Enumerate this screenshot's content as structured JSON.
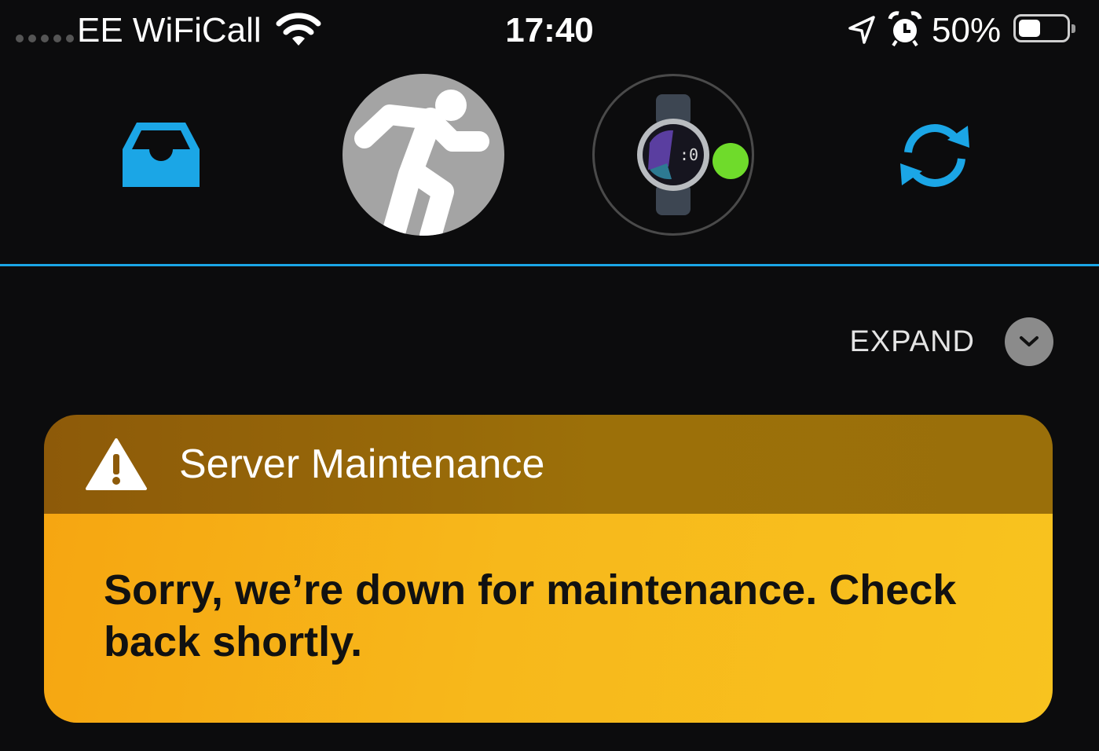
{
  "status_bar": {
    "carrier": "EE WiFiCall",
    "time": "17:40",
    "battery_percent": "50%",
    "battery_level": 0.5,
    "icons": [
      "signal-dots-icon",
      "wifi-icon",
      "location-arrow-icon",
      "alarm-clock-icon",
      "battery-icon"
    ]
  },
  "nav": {
    "items": [
      {
        "name": "inbox",
        "icon": "inbox-tray-icon"
      },
      {
        "name": "profile",
        "icon": "running-person-icon"
      },
      {
        "name": "device",
        "icon": "smartwatch-icon",
        "connected": true
      },
      {
        "name": "sync",
        "icon": "sync-icon"
      }
    ],
    "accent_color": "#1ba6e6",
    "connected_color": "#6fdb2b"
  },
  "expand": {
    "label": "EXPAND",
    "icon": "chevron-down-icon"
  },
  "alert": {
    "icon": "warning-triangle-icon",
    "title": "Server Maintenance",
    "message": "Sorry, we’re down for maintenance. Check back shortly.",
    "header_color": "#9a6a0a",
    "body_color": "#f7b81b"
  }
}
